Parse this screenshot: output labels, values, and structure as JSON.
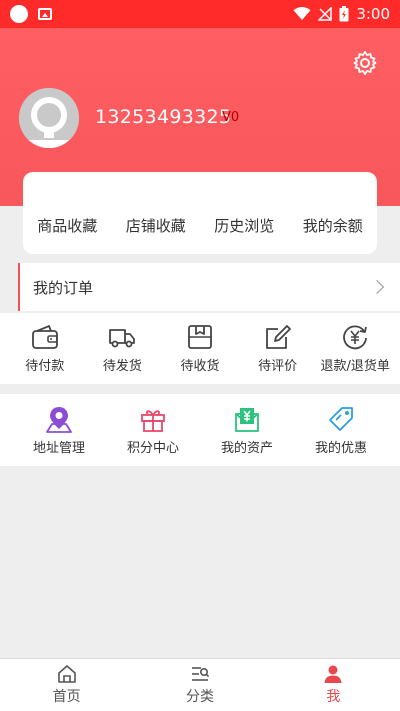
{
  "status": {
    "time": "3:00"
  },
  "profile": {
    "phone": "13253493325",
    "level": "V0"
  },
  "stats": [
    {
      "label": "商品收藏"
    },
    {
      "label": "店铺收藏"
    },
    {
      "label": "历史浏览"
    },
    {
      "label": "我的余额"
    }
  ],
  "orders": {
    "title": "我的订单",
    "items": [
      {
        "label": "待付款",
        "icon": "wallet-icon"
      },
      {
        "label": "待发货",
        "icon": "truck-icon"
      },
      {
        "label": "待收货",
        "icon": "box-icon"
      },
      {
        "label": "待评价",
        "icon": "edit-icon"
      },
      {
        "label": "退款/退货单",
        "icon": "refund-icon"
      }
    ]
  },
  "tools": [
    {
      "label": "地址管理",
      "icon": "location-icon",
      "color": "#8a4dd6"
    },
    {
      "label": "积分中心",
      "icon": "gift-icon",
      "color": "#e84a6c"
    },
    {
      "label": "我的资产",
      "icon": "asset-icon",
      "color": "#2ec27e"
    },
    {
      "label": "我的优惠",
      "icon": "coupon-icon",
      "color": "#2a9fe0"
    }
  ],
  "nav": [
    {
      "label": "首页",
      "icon": "home-icon"
    },
    {
      "label": "分类",
      "icon": "category-icon"
    },
    {
      "label": "我",
      "icon": "user-icon",
      "active": true
    }
  ],
  "colors": {
    "header": "#ff5f63",
    "statusbar": "#ff2a2a",
    "accent": "#e8484d"
  }
}
